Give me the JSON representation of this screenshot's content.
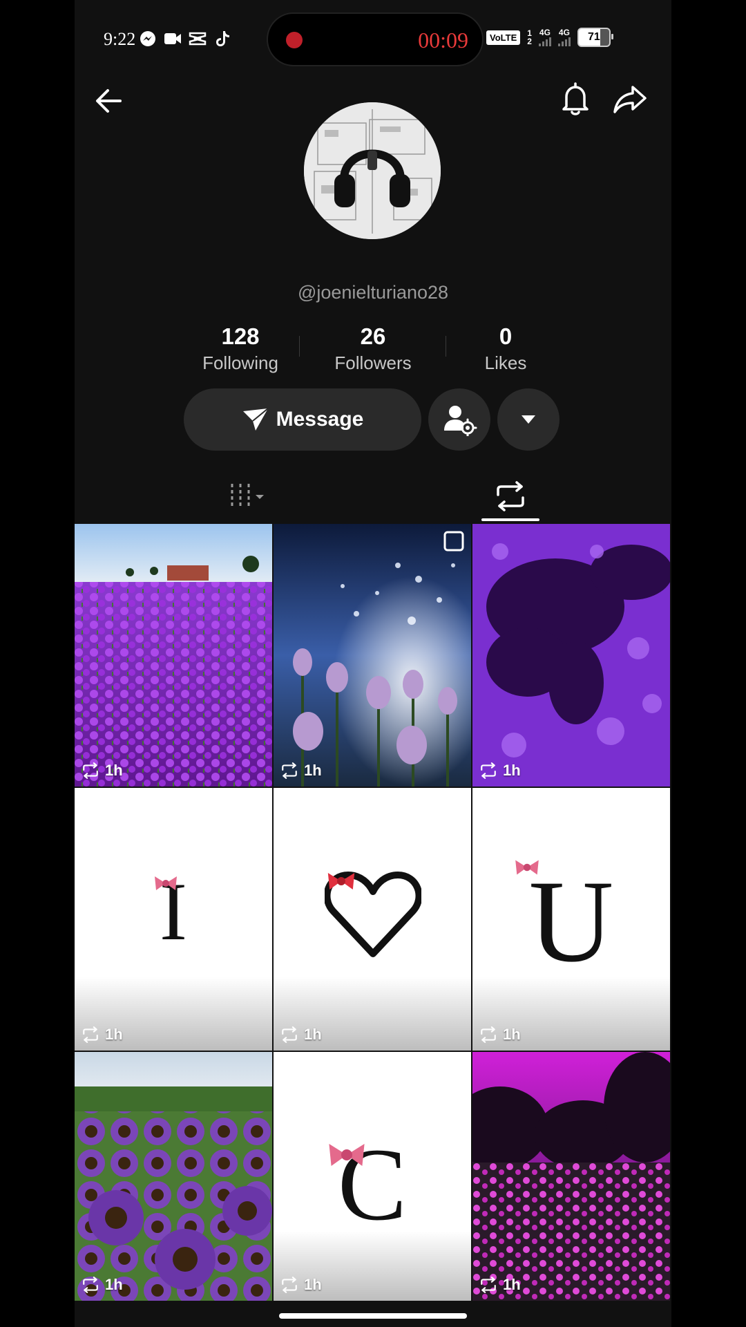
{
  "status_bar": {
    "time": "9:22",
    "recording_time": "00:09",
    "volte": "VoLTE",
    "sim1": "1",
    "sim2": "2",
    "net1": "4G",
    "net2": "4G",
    "battery": "71"
  },
  "profile": {
    "username": "@joenielturiano28",
    "stats": [
      {
        "value": "128",
        "label": "Following"
      },
      {
        "value": "26",
        "label": "Followers"
      },
      {
        "value": "0",
        "label": "Likes"
      }
    ],
    "message_label": "Message"
  },
  "tabs": {
    "active": "reposts"
  },
  "grid": {
    "items": [
      {
        "meta": "1h",
        "kind": "photo-lavender-field"
      },
      {
        "meta": "1h",
        "kind": "photo-tulips-water"
      },
      {
        "meta": "1h",
        "kind": "photo-purple-tree"
      },
      {
        "meta": "1h",
        "kind": "letter",
        "text": "I"
      },
      {
        "meta": "1h",
        "kind": "heart"
      },
      {
        "meta": "1h",
        "kind": "letter",
        "text": "U"
      },
      {
        "meta": "1h",
        "kind": "photo-sunflowers"
      },
      {
        "meta": "1h",
        "kind": "letter",
        "text": "C"
      },
      {
        "meta": "1h",
        "kind": "photo-pink-meadow"
      }
    ]
  },
  "colors": {
    "background": "#111111",
    "button": "#2a2a2a",
    "recording": "#e83a3a"
  }
}
